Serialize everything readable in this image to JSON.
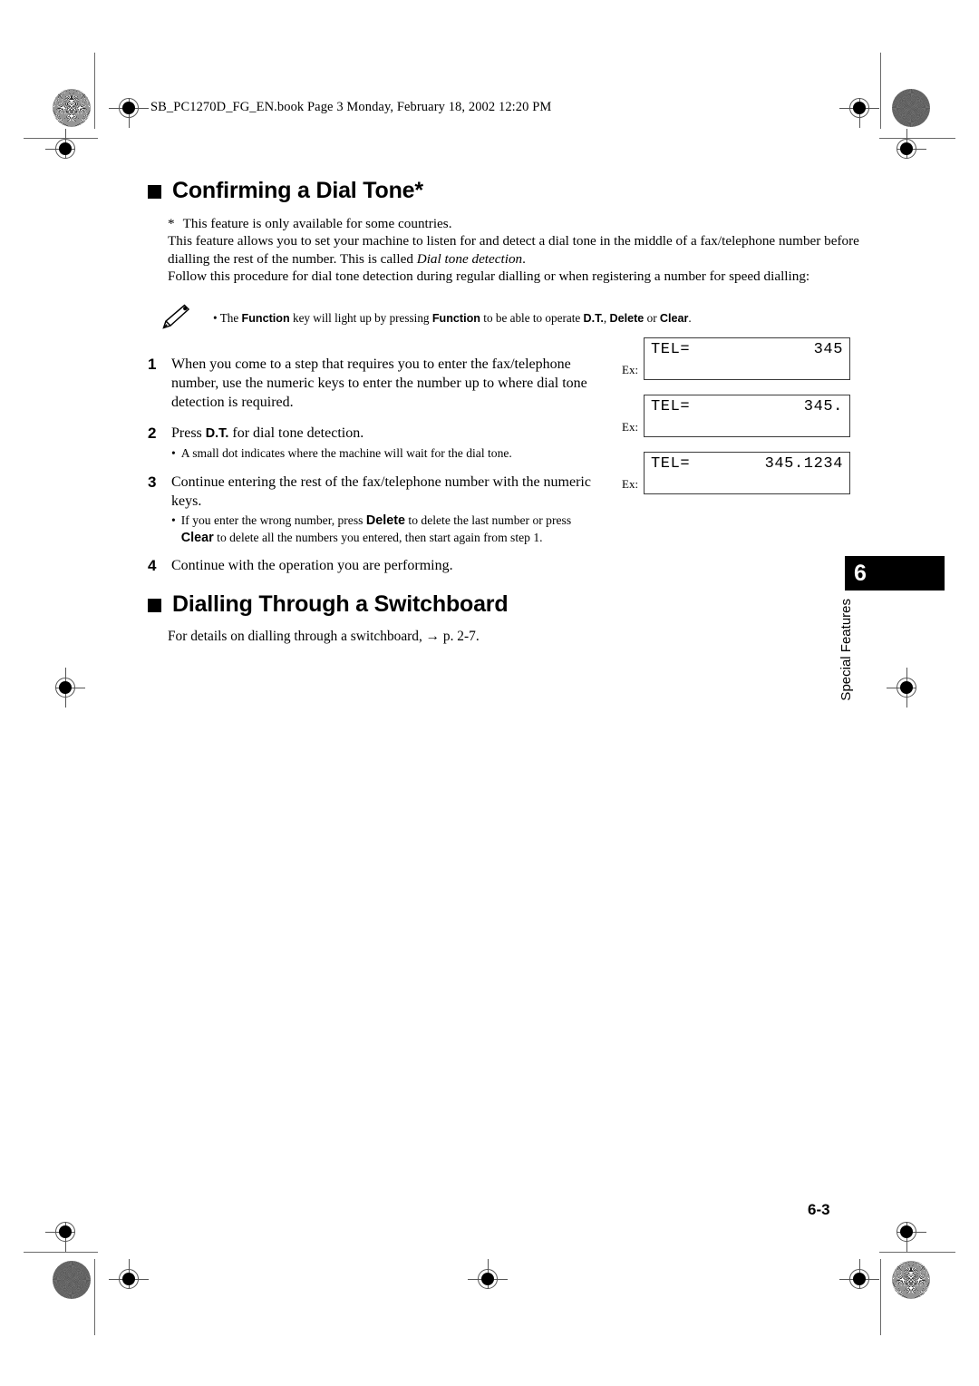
{
  "page": {
    "book_header": "SB_PC1270D_FG_EN.book  Page 3  Monday, February 18, 2002  12:20 PM",
    "folio": "6-3"
  },
  "chapter_tab": {
    "number": "6",
    "name": "Special Features"
  },
  "sections": [
    {
      "heading": "Confirming a Dial Tone*",
      "footnote_marker": "*",
      "footnote": "This feature is only available for some countries.",
      "paragraph_1_a": "This feature allows you to set your machine to listen for and detect a dial tone in the middle of a fax/telephone number before dialling the rest of the number. This is called ",
      "paragraph_1_italic": "Dial tone detection",
      "paragraph_1_b": ".",
      "paragraph_2": "Follow this procedure for dial tone detection during regular dialling or when registering a number for speed dialling:"
    },
    {
      "heading": "Dialling Through a Switchboard",
      "body": "For details on dialling through a switchboard, → p. 2-7."
    }
  ],
  "note": {
    "icon": "pencil-icon",
    "bullet": "•",
    "text_1": "The ",
    "bold_1": "Function",
    "text_2": " key will light up by pressing ",
    "bold_2": "Function",
    "text_3": " to be able to operate ",
    "bold_3": "D.T.",
    "text_4": ", ",
    "bold_4": "Delete",
    "text_5": " or ",
    "bold_5": "Clear",
    "text_6": "."
  },
  "steps": [
    {
      "number": "1",
      "text": "When you come to a step that requires you to enter the fax/telephone number, use the numeric keys to enter the number up to where dial tone detection is required."
    },
    {
      "number": "2",
      "text_a": "Press ",
      "bold_a": "D.T.",
      "text_b": " for dial tone detection.",
      "sub_bullet": "•",
      "sub_text": "A small dot indicates where the machine will wait for the dial tone."
    },
    {
      "number": "3",
      "text": "Continue entering the rest of the fax/telephone number with the numeric keys.",
      "sub_bullet": "•",
      "sub_text_a": "If you enter the wrong number, press ",
      "sub_bold_a": "Delete",
      "sub_text_b": " to delete the last number or press ",
      "sub_bold_b": "Clear",
      "sub_text_c": " to delete all the numbers you entered, then start again from step 1."
    },
    {
      "number": "4",
      "text": "Continue with the operation you are performing."
    }
  ],
  "lcd_examples": [
    {
      "ex_label": "Ex:",
      "prompt": "TEL=",
      "value": "345"
    },
    {
      "ex_label": "Ex:",
      "prompt": "TEL=",
      "value": "345."
    },
    {
      "ex_label": "Ex:",
      "prompt": "TEL=",
      "value": "345.1234"
    }
  ]
}
